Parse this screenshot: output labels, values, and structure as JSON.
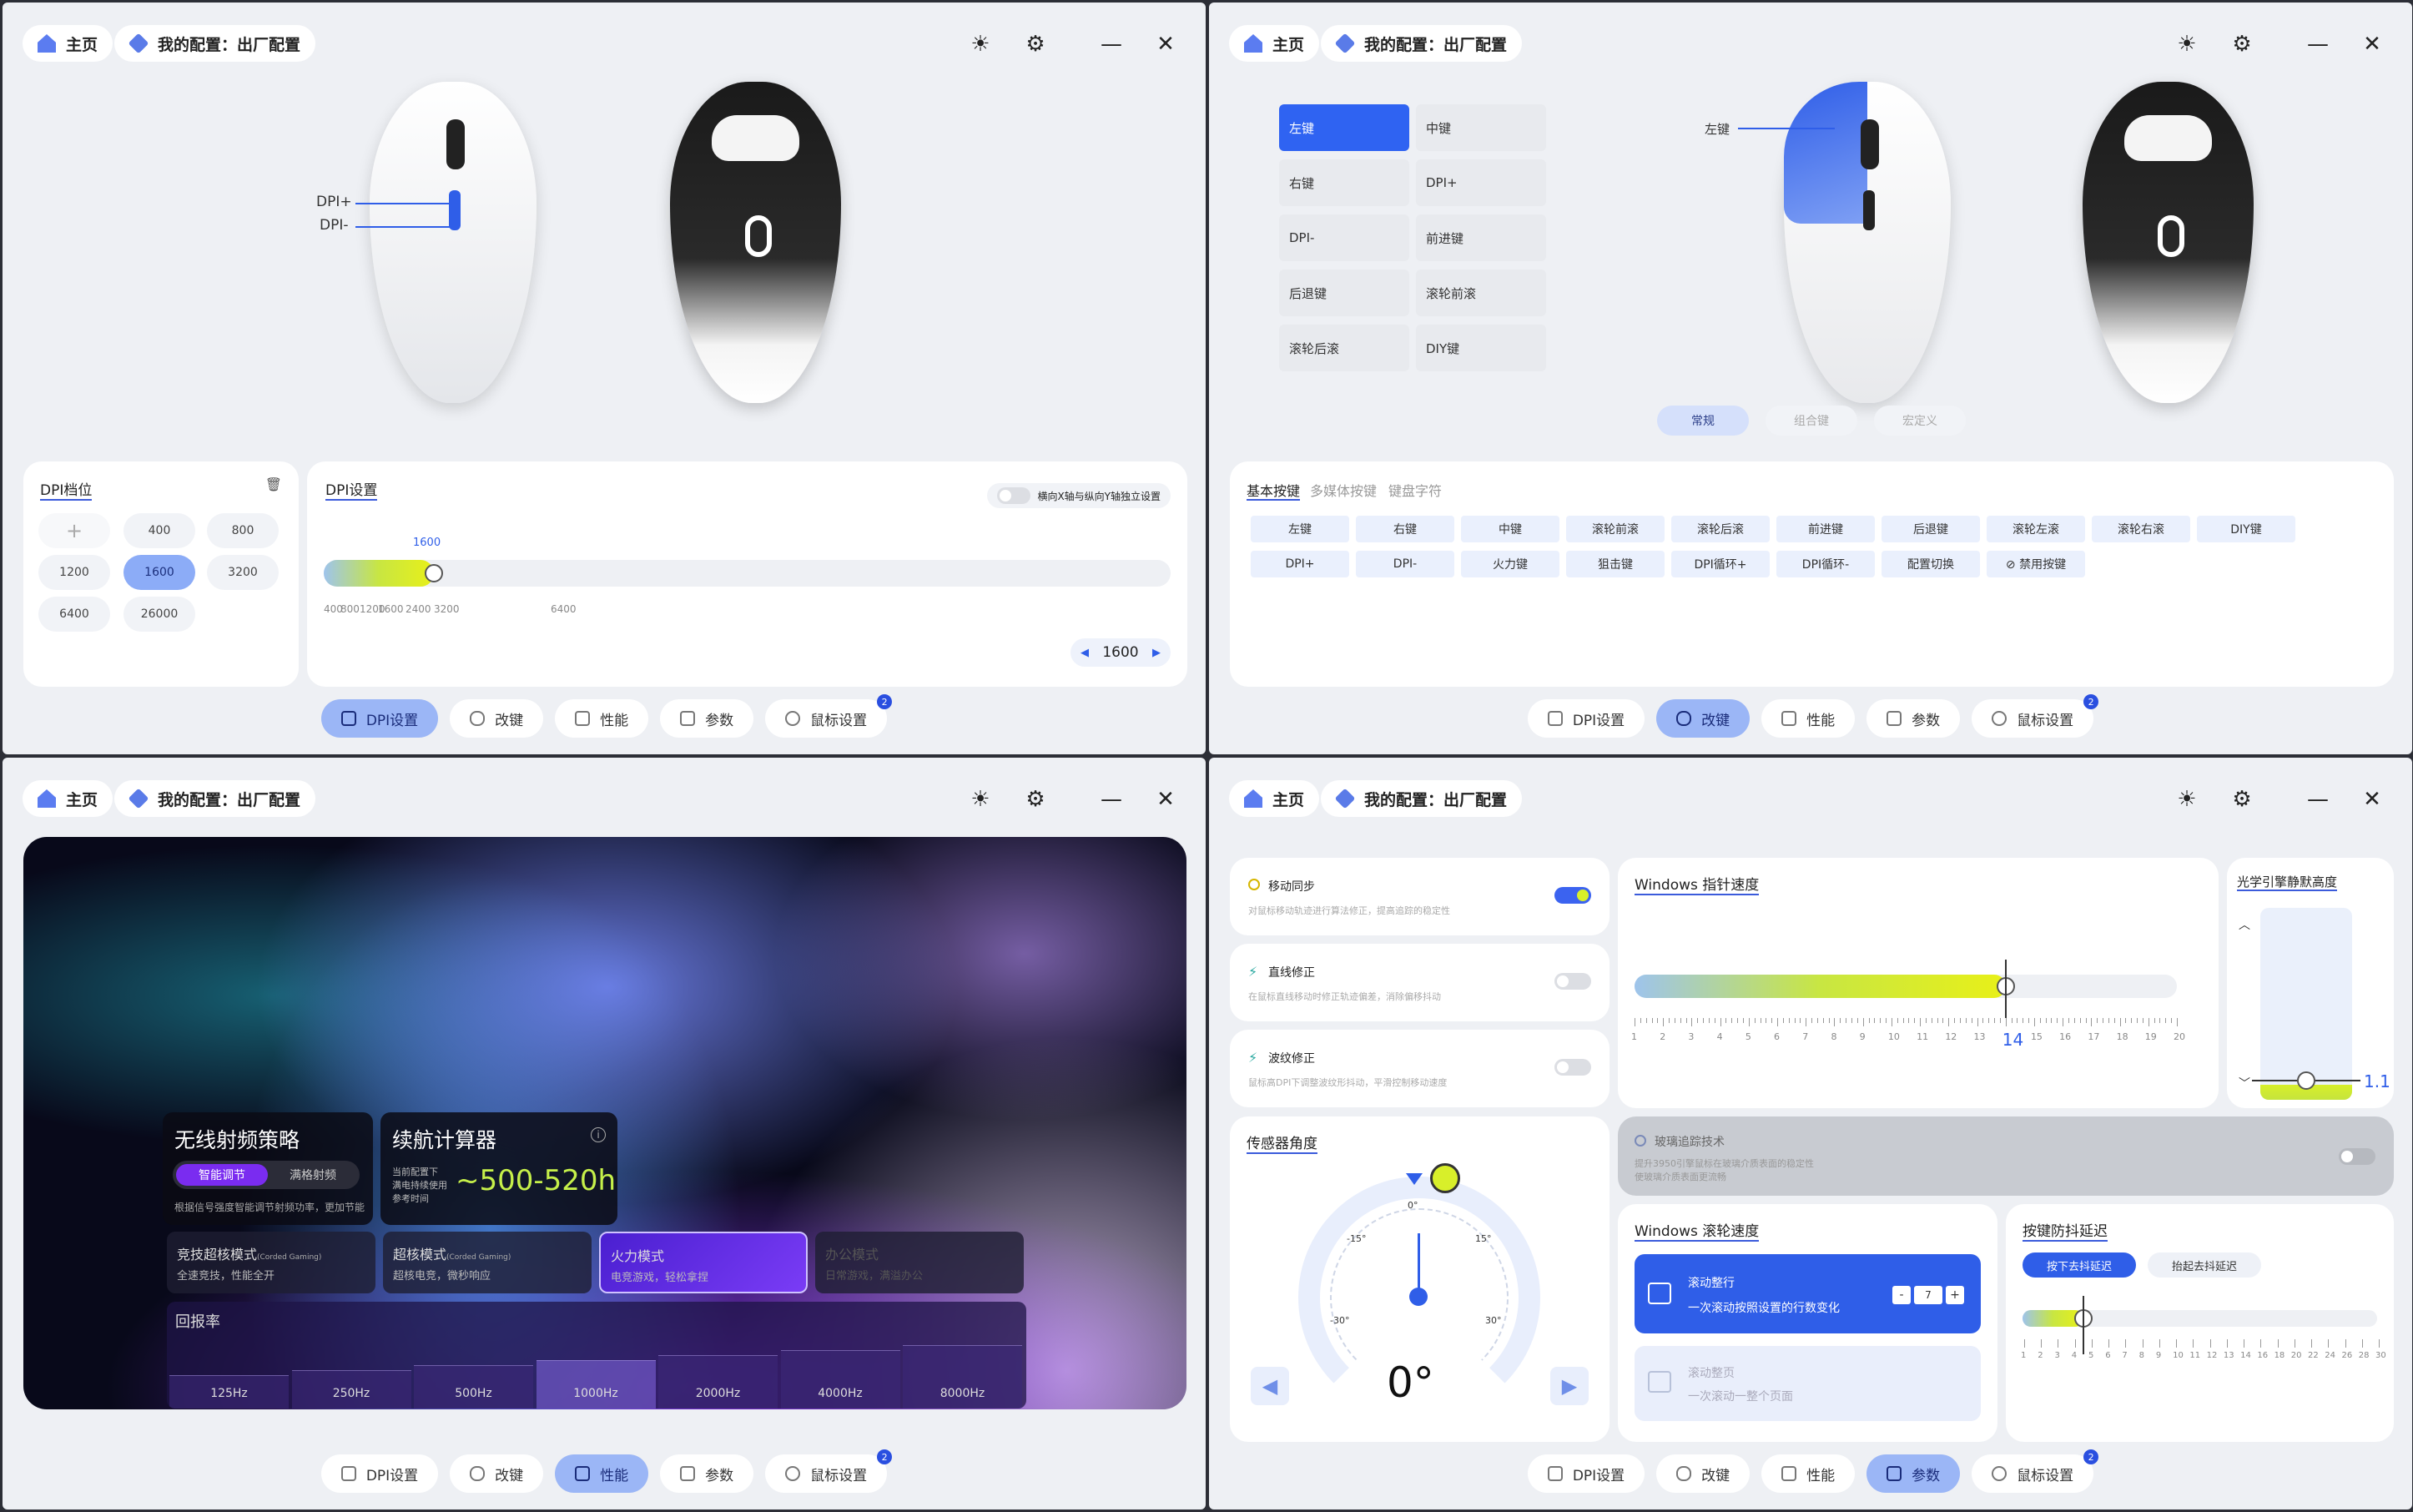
{
  "titlebar": {
    "home": "主页",
    "profile": "我的配置：出厂配置"
  },
  "tabs": [
    {
      "label": "DPI设置",
      "icon": "sliders-icon"
    },
    {
      "label": "改键",
      "icon": "mouse-icon"
    },
    {
      "label": "性能",
      "icon": "chart-icon"
    },
    {
      "label": "参数",
      "icon": "grid-icon"
    },
    {
      "label": "鼠标设置",
      "icon": "info-icon",
      "badge": "2"
    }
  ],
  "dpi": {
    "callout_plus": "DPI+",
    "callout_minus": "DPI-",
    "levels_title": "DPI档位",
    "levels": [
      "400",
      "800",
      "1200",
      "1600",
      "3200",
      "6400",
      "26000"
    ],
    "selected_level": "1600",
    "settings_title": "DPI设置",
    "xy_toggle_label": "横向X轴与纵向Y轴独立设置",
    "current_value": "1600",
    "slider_top": "1600",
    "ticks": [
      "400",
      "800",
      "1200",
      "1600",
      "2400",
      "3200",
      "6400"
    ],
    "max": 26000,
    "stepper_value": "1600"
  },
  "remap": {
    "callout": "左键",
    "keys": [
      "左键",
      "中键",
      "右键",
      "DPI+",
      "DPI-",
      "前进键",
      "后退键",
      "滚轮前滚",
      "滚轮后滚",
      "DIY键"
    ],
    "selected": "左键",
    "segments": [
      "常规",
      "组合键",
      "宏定义"
    ],
    "selected_segment": "常规",
    "sub_tabs": [
      "基本按键",
      "多媒体按键",
      "键盘字符"
    ],
    "basic_keys_row1": [
      "左键",
      "右键",
      "中键",
      "滚轮前滚",
      "滚轮后滚",
      "前进键",
      "后退键",
      "滚轮左滚",
      "滚轮右滚",
      "DIY键"
    ],
    "basic_keys_row2": [
      "DPI+",
      "DPI-",
      "火力键",
      "狙击键",
      "DPI循环+",
      "DPI循环-",
      "配置切换",
      "禁用按键"
    ]
  },
  "perf": {
    "strategy_title": "无线射频策略",
    "strategy_on": "智能调节",
    "strategy_off": "满格射频",
    "strategy_desc": "根据信号强度智能调节射频功率，更加节能",
    "battery_title": "续航计算器",
    "battery_desc1": "当前配置下",
    "battery_desc2": "满电持续使用",
    "battery_desc3": "参考时间",
    "battery_value": "~500-520h",
    "modes": [
      {
        "name": "竞技超核模式",
        "tag": "(Corded Gaming)",
        "desc": "全速竞技，性能全开"
      },
      {
        "name": "超核模式",
        "tag": "(Corded Gaming)",
        "desc": "超核电竞，微秒响应"
      },
      {
        "name": "火力模式",
        "tag": "",
        "desc": "电竞游戏，轻松拿捏"
      },
      {
        "name": "办公模式",
        "tag": "",
        "desc": "日常游戏，满溢办公"
      }
    ],
    "selected_mode": 2,
    "poll_title": "回报率",
    "poll_rates": [
      "125Hz",
      "250Hz",
      "500Hz",
      "1000Hz",
      "2000Hz",
      "4000Hz",
      "8000Hz"
    ],
    "selected_rate": "1000Hz"
  },
  "params": {
    "sync_title": "移动同步",
    "sync_desc": "对鼠标移动轨迹进行算法修正，提高追踪的稳定性",
    "sync_on": true,
    "straight_title": "直线修正",
    "straight_desc": "在鼠标直线移动时修正轨迹偏差，消除偏移抖动",
    "straight_on": false,
    "ripple_title": "波纹修正",
    "ripple_desc": "鼠标高DPI下调整波纹形抖动，平滑控制移动速度",
    "ripple_on": false,
    "pointer_title": "Windows 指针速度",
    "pointer_value": "14",
    "pointer_ticks": [
      "1",
      "2",
      "3",
      "4",
      "5",
      "6",
      "7",
      "8",
      "9",
      "10",
      "11",
      "12",
      "13",
      "14",
      "15",
      "16",
      "17",
      "18",
      "19",
      "20"
    ],
    "lod_title": "光学引擎静默高度",
    "lod_value": "1.1",
    "glass_title": "玻璃追踪技术",
    "glass_desc1": "提升3950引擎鼠标在玻璃介质表面的稳定性",
    "glass_desc2": "使玻璃介质表面更流畅",
    "angle_title": "传感器角度",
    "angle_value": "0°",
    "angle_marks": [
      "0°",
      "-15°",
      "15°",
      "-30°",
      "30°"
    ],
    "scroll_title": "Windows 滚轮速度",
    "scroll_line_title": "滚动整行",
    "scroll_line_desc": "一次滚动按照设置的行数变化",
    "scroll_lines": "7",
    "scroll_page_title": "滚动整页",
    "scroll_page_desc": "一次滚动一整个页面",
    "debounce_title": "按键防抖延迟",
    "debounce_press": "按下去抖延迟",
    "debounce_release": "抬起去抖延迟",
    "debounce_ticks": [
      "1",
      "2",
      "3",
      "4",
      "5",
      "6",
      "7",
      "8",
      "9",
      "10",
      "11",
      "12",
      "13",
      "14",
      "16",
      "18",
      "20",
      "22",
      "24",
      "26",
      "28",
      "30"
    ],
    "debounce_value": "6"
  }
}
